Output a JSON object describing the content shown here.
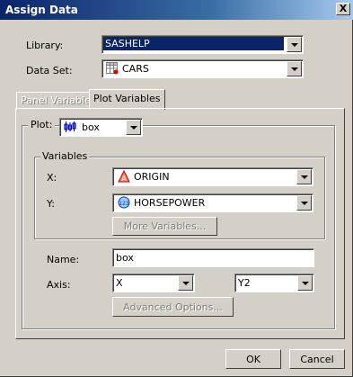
{
  "window": {
    "title": "Assign Data",
    "close_glyph": "X"
  },
  "library": {
    "label": "Library:",
    "value": "SASHELP"
  },
  "dataset": {
    "label": "Data Set:",
    "value": "CARS",
    "icon": "dataset-table-icon"
  },
  "tabs": [
    {
      "label": "Panel Variables",
      "active": false,
      "enabled": false
    },
    {
      "label": "Plot Variables",
      "active": true,
      "enabled": true
    }
  ],
  "plot": {
    "label": "Plot:",
    "value": "box",
    "icon": "box-plot-icon"
  },
  "variables": {
    "legend": "Variables",
    "x_label": "X:",
    "x_value": "ORIGIN",
    "x_icon": "character-variable-icon",
    "y_label": "Y:",
    "y_value": "HORSEPOWER",
    "y_icon": "numeric-variable-icon",
    "more_label": "More Variables..."
  },
  "name": {
    "label": "Name:",
    "value": "box"
  },
  "axis": {
    "label": "Axis:",
    "x_value": "X",
    "y_value": "Y2"
  },
  "advanced_label": "Advanced Options...",
  "buttons": {
    "ok": "OK",
    "cancel": "Cancel"
  },
  "colors": {
    "title_bar": "#0a246a",
    "face": "#d4d0c8",
    "selection": "#0a246a"
  }
}
